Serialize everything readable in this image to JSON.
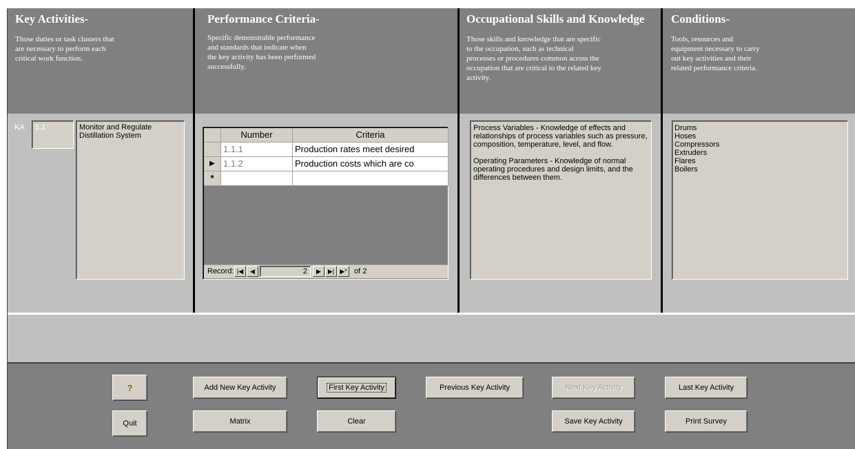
{
  "columns": [
    {
      "title": "Key Activities-",
      "description": "Those duties or task clusters that\nare necessary to perform each\ncritical work function."
    },
    {
      "title": "Performance Criteria-",
      "description": "Specific demonstrable performance\nand standards that indicate when\nthe key activity has been performed\nsuccessfully."
    },
    {
      "title": "Occupational Skills and Knowledge",
      "description": "Those skills and knowledge that are specific\nto the occupation, such as technical\nprocesses or procedures common across the\noccupation that are critical to the related key\nactivity."
    },
    {
      "title": "Conditions-",
      "description": "Tools, resources and\nequipment necessary to carry\nout key activities and their\nrelated performance criteria."
    }
  ],
  "key_activity": {
    "prefix": "KA",
    "number": "1.1",
    "text": "Monitor and Regulate Distillation System"
  },
  "criteria_grid": {
    "headers": [
      "Number",
      "Criteria"
    ],
    "rows": [
      {
        "number": "1.1.1",
        "criteria": "Production rates meet desired",
        "selector": ""
      },
      {
        "number": "1.1.2",
        "criteria": "Production costs which are co",
        "selector": "▶"
      }
    ],
    "new_row_marker": "*",
    "nav": {
      "label": "Record:",
      "current": "2",
      "of_text": "of 2",
      "first": "|◀",
      "prev": "◀",
      "next": "▶",
      "last": "▶|",
      "new": "▶*"
    }
  },
  "skills_text": "Process Variables - Knowledge of effects and relationships of process variables such as pressure, composition, temperature, level, and flow.\n\nOperating Parameters - Knowledge of normal operating procedures and design limits, and the differences between them.",
  "conditions_text": "Drums\nHoses\nCompressors\nExtruders\nFlares\nBoilers",
  "buttons": {
    "help": "?",
    "quit": "Quit",
    "add_new": "Add New Key Activity",
    "matrix": "Matrix",
    "first": "First Key Activity",
    "clear": "Clear",
    "previous": "Previous Key Activity",
    "next": "Next Key Activity",
    "save": "Save Key Activity",
    "last": "Last Key Activity",
    "print": "Print Survey"
  }
}
